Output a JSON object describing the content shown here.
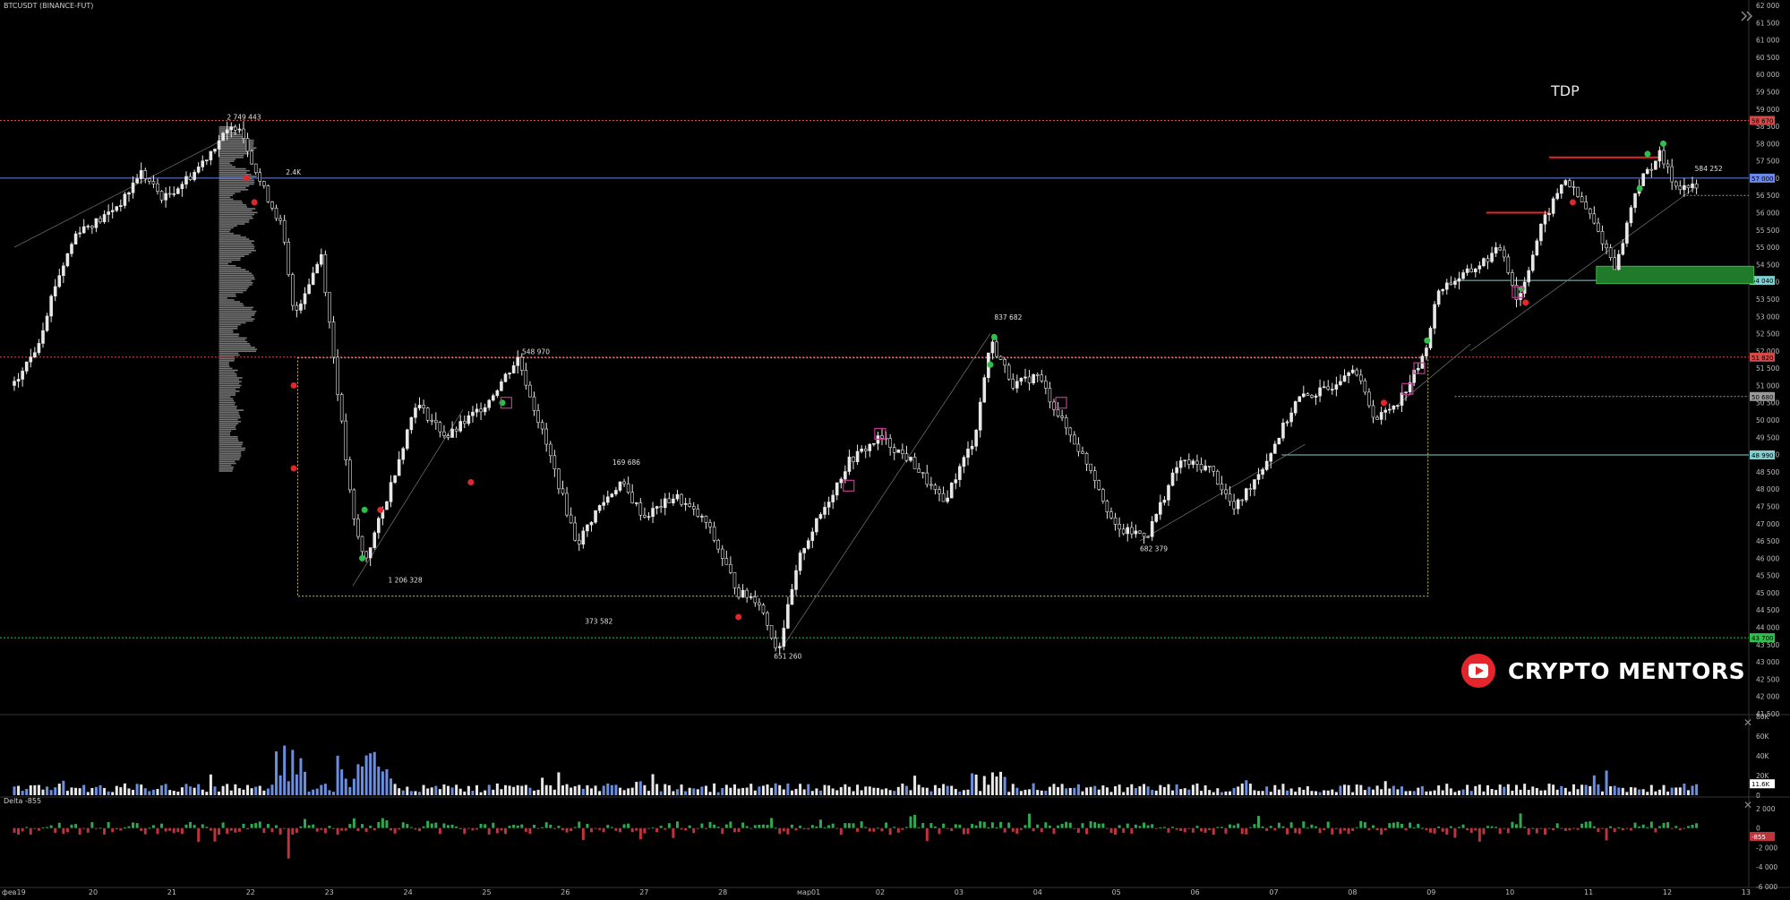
{
  "symbol_title": "BTCUSDT (BINANCE-FUT)",
  "overlay_label": "TDP",
  "brand": {
    "name": "CRYPTO MENTORS",
    "logo": "youtube-logo-icon"
  },
  "delta_label": "Delta -855",
  "icons": {
    "expand": "chevron-double-right-icon",
    "close": "close-icon"
  },
  "colors": {
    "background": "#000000",
    "candle": "#e8e8e8",
    "volume_up": "#6b8fe0",
    "volume_base": "#e8e8e8",
    "delta_positive": "#2fa84f",
    "delta_negative": "#c0333b",
    "green_zone": "#1f7a2a",
    "pink_box": "#c0398f",
    "red_marker": "#e02828",
    "green_marker": "#2ec04a",
    "resistance_red": "#d24a4a",
    "blue_level": "#6c87e6",
    "cyan_level": "#7fd0d0",
    "yellow_box": "#d8c25a"
  },
  "chart_data": [
    {
      "type": "candlestick",
      "title": "BTCUSDT (BINANCE-FUT)",
      "x_ticks": [
        "фев19",
        "20",
        "21",
        "22",
        "23",
        "24",
        "25",
        "26",
        "27",
        "28",
        "мар01",
        "02",
        "03",
        "04",
        "05",
        "06",
        "07",
        "08",
        "09",
        "10",
        "11",
        "12",
        "13"
      ],
      "y_ticks": [
        "62 000",
        "61 500",
        "61 000",
        "60 500",
        "60 000",
        "59 500",
        "59 000",
        "58 500",
        "58 000",
        "57 500",
        "57 000",
        "56 500",
        "56 000",
        "55 500",
        "55 000",
        "54 500",
        "54 000",
        "53 500",
        "53 000",
        "52 500",
        "52 000",
        "51 500",
        "51 000",
        "50 500",
        "50 000",
        "49 500",
        "49 000",
        "48 500",
        "48 000",
        "47 500",
        "47 000",
        "46 500",
        "46 000",
        "45 500",
        "45 000",
        "44 500",
        "44 000",
        "43 500",
        "43 000",
        "42 500",
        "42 000",
        "41 500"
      ],
      "ylim": [
        41500,
        62000
      ],
      "price_path": [
        {
          "x": 0.0,
          "y": 51000
        },
        {
          "x": 0.3,
          "y": 52200
        },
        {
          "x": 0.5,
          "y": 53800
        },
        {
          "x": 0.8,
          "y": 55500
        },
        {
          "x": 1.1,
          "y": 55800
        },
        {
          "x": 1.4,
          "y": 56400
        },
        {
          "x": 1.6,
          "y": 57200
        },
        {
          "x": 1.9,
          "y": 56400
        },
        {
          "x": 2.3,
          "y": 57200
        },
        {
          "x": 2.6,
          "y": 58100
        },
        {
          "x": 2.85,
          "y": 58600
        },
        {
          "x": 3.1,
          "y": 57000
        },
        {
          "x": 3.4,
          "y": 55600
        },
        {
          "x": 3.55,
          "y": 53000
        },
        {
          "x": 3.9,
          "y": 54800
        },
        {
          "x": 4.1,
          "y": 51000
        },
        {
          "x": 4.3,
          "y": 47200
        },
        {
          "x": 4.45,
          "y": 45900
        },
        {
          "x": 4.7,
          "y": 47500
        },
        {
          "x": 5.1,
          "y": 50500
        },
        {
          "x": 5.5,
          "y": 49500
        },
        {
          "x": 6.0,
          "y": 50500
        },
        {
          "x": 6.4,
          "y": 51800
        },
        {
          "x": 6.8,
          "y": 49000
        },
        {
          "x": 7.15,
          "y": 46400
        },
        {
          "x": 7.4,
          "y": 47400
        },
        {
          "x": 7.7,
          "y": 48200
        },
        {
          "x": 8.0,
          "y": 47200
        },
        {
          "x": 8.4,
          "y": 47800
        },
        {
          "x": 8.8,
          "y": 47000
        },
        {
          "x": 9.2,
          "y": 45000
        },
        {
          "x": 9.45,
          "y": 44800
        },
        {
          "x": 9.7,
          "y": 43300
        },
        {
          "x": 10.0,
          "y": 46200
        },
        {
          "x": 10.3,
          "y": 47500
        },
        {
          "x": 10.6,
          "y": 48800
        },
        {
          "x": 11.0,
          "y": 49500
        },
        {
          "x": 11.4,
          "y": 48800
        },
        {
          "x": 11.8,
          "y": 47600
        },
        {
          "x": 12.2,
          "y": 49500
        },
        {
          "x": 12.4,
          "y": 52300
        },
        {
          "x": 12.7,
          "y": 51000
        },
        {
          "x": 13.0,
          "y": 51300
        },
        {
          "x": 13.3,
          "y": 50000
        },
        {
          "x": 13.7,
          "y": 48500
        },
        {
          "x": 14.0,
          "y": 46800
        },
        {
          "x": 14.4,
          "y": 46700
        },
        {
          "x": 14.8,
          "y": 48800
        },
        {
          "x": 15.2,
          "y": 48600
        },
        {
          "x": 15.5,
          "y": 47400
        },
        {
          "x": 15.9,
          "y": 48800
        },
        {
          "x": 16.3,
          "y": 50600
        },
        {
          "x": 16.7,
          "y": 50900
        },
        {
          "x": 17.0,
          "y": 51600
        },
        {
          "x": 17.3,
          "y": 50000
        },
        {
          "x": 17.6,
          "y": 50600
        },
        {
          "x": 17.9,
          "y": 51800
        },
        {
          "x": 18.1,
          "y": 53800
        },
        {
          "x": 18.5,
          "y": 54300
        },
        {
          "x": 18.9,
          "y": 55000
        },
        {
          "x": 19.1,
          "y": 53400
        },
        {
          "x": 19.4,
          "y": 55600
        },
        {
          "x": 19.7,
          "y": 57000
        },
        {
          "x": 20.0,
          "y": 56000
        },
        {
          "x": 20.35,
          "y": 54400
        },
        {
          "x": 20.6,
          "y": 56700
        },
        {
          "x": 20.9,
          "y": 57700
        },
        {
          "x": 21.1,
          "y": 56800
        },
        {
          "x": 21.4,
          "y": 56700
        }
      ],
      "horizontal_levels": [
        {
          "price": 58670,
          "label": "58 670",
          "color": "#d24a4a",
          "style": "dotted"
        },
        {
          "price": 57000,
          "label": "57 000",
          "color": "#6c87e6",
          "style": "solid"
        },
        {
          "price": 56500,
          "label": "",
          "color": "#9a9a9a",
          "style": "dotted"
        },
        {
          "price": 54040,
          "label": "54 040",
          "color": "#7fd0d0",
          "style": "solid"
        },
        {
          "price": 51820,
          "label": "51 820",
          "color": "#d24a4a",
          "style": "dotted"
        },
        {
          "price": 50680,
          "label": "50 680",
          "color": "#9a9a9a",
          "style": "dotted"
        },
        {
          "price": 48990,
          "label": "48 990",
          "color": "#7fd0d0",
          "style": "solid"
        },
        {
          "price": 43700,
          "label": "43 700",
          "color": "#2ec04a",
          "style": "dotted"
        }
      ],
      "annotations": [
        {
          "text": "2 749 443",
          "x": 2.7,
          "y": 58700
        },
        {
          "text": "2.4K",
          "x": 3.45,
          "y": 57100
        },
        {
          "text": "548 970",
          "x": 6.45,
          "y": 51900
        },
        {
          "text": "1 206 328",
          "x": 4.75,
          "y": 45300
        },
        {
          "text": "169 686",
          "x": 7.6,
          "y": 48700
        },
        {
          "text": "373 582",
          "x": 7.25,
          "y": 44100
        },
        {
          "text": "651 260",
          "x": 9.65,
          "y": 43100
        },
        {
          "text": "837 682",
          "x": 12.45,
          "y": 52900
        },
        {
          "text": "682 379",
          "x": 14.3,
          "y": 46200
        },
        {
          "text": "584 252",
          "x": 21.35,
          "y": 57200
        }
      ]
    },
    {
      "type": "bar",
      "title": "",
      "y_ticks": [
        "80K",
        "60K",
        "40K",
        "20K",
        "0"
      ],
      "last_value": "11.6K",
      "ylim": [
        0,
        80000
      ]
    },
    {
      "type": "bar",
      "title": "Delta -855",
      "y_ticks": [
        "2 000",
        "0",
        "-2 000",
        "-4 000",
        "-6 000"
      ],
      "last_value": "-855",
      "ylim": [
        -6000,
        3000
      ]
    }
  ]
}
